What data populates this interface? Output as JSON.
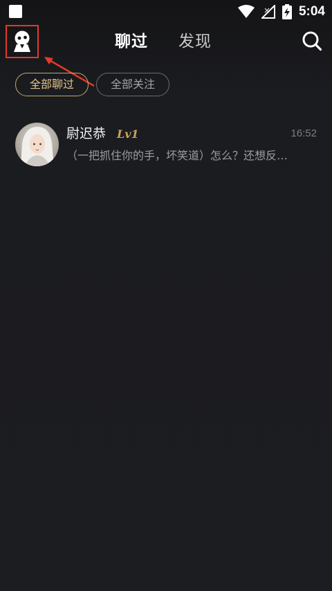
{
  "status_bar": {
    "time": "5:04"
  },
  "header": {
    "tabs": [
      {
        "label": "聊过",
        "active": true
      },
      {
        "label": "发现",
        "active": false
      }
    ]
  },
  "filters": {
    "chips": [
      {
        "label": "全部聊过",
        "active": true
      },
      {
        "label": "全部关注",
        "active": false
      }
    ]
  },
  "chats": [
    {
      "name": "尉迟恭",
      "level": "Lv1",
      "time": "16:52",
      "preview": "（一把抓住你的手，坏笑道）怎么？还想反…"
    }
  ],
  "colors": {
    "background": "#1c1d21",
    "accent_gold": "#c9a86a",
    "annotation_red": "#e23a2a"
  },
  "icons": {
    "app": "ghost-avatar-icon",
    "search": "search-icon",
    "wifi": "wifi-icon",
    "signal": "no-signal-icon",
    "battery": "battery-charging-icon"
  }
}
